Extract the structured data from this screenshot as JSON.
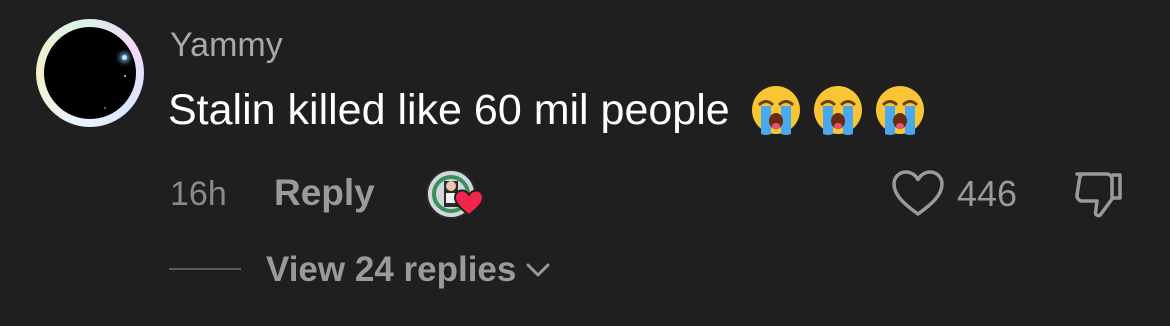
{
  "comment": {
    "username": "Yammy",
    "text": "Stalin killed like 60 mil people",
    "emojis": [
      "loudly-crying-face",
      "loudly-crying-face",
      "loudly-crying-face"
    ],
    "timestamp": "16h",
    "reply_label": "Reply",
    "like_count": "446",
    "view_replies_label": "View 24 replies"
  },
  "colors": {
    "background": "#1f1f1f",
    "text_primary": "#ffffff",
    "text_secondary": "#9a9a9a",
    "heart_accent": "#f4254a"
  },
  "icons": {
    "like": "heart-outline-icon",
    "dislike": "thumbs-down-icon",
    "expand": "chevron-down-icon",
    "creator_liked": "heart-filled-icon"
  }
}
